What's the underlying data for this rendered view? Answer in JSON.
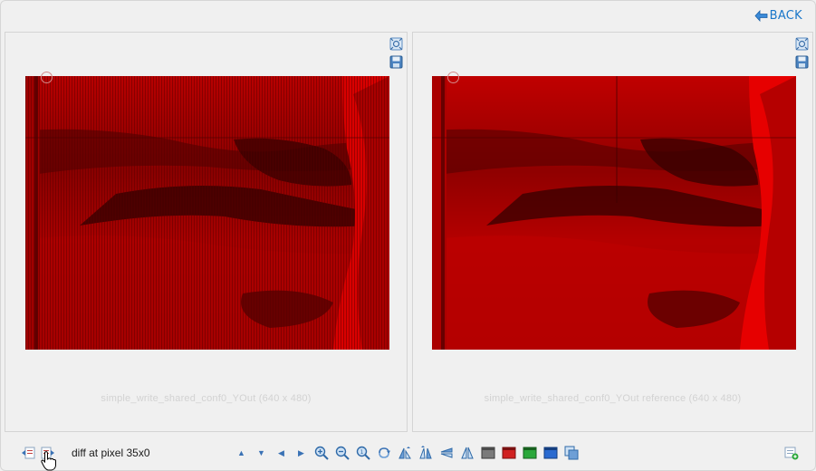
{
  "header": {
    "back_label": "BACK"
  },
  "panels": {
    "left": {
      "caption": "simple_write_shared_conf0_YOut (640 x 480)"
    },
    "right": {
      "caption": "simple_write_shared_conf0_YOut reference (640 x 480)"
    }
  },
  "status": {
    "text": "diff at pixel 35x0"
  },
  "toolbar": {
    "nav_icons": [
      "arrow-up-icon",
      "arrow-down-icon",
      "arrow-left-icon",
      "arrow-right-icon"
    ],
    "tool_icons": [
      "zoom-in-icon",
      "zoom-out-icon",
      "zoom-fit-icon",
      "rotate-icon",
      "flip-vertical-icon",
      "mirror-icon",
      "flip-horizontal-icon",
      "flip-icon",
      "grayscale-channel-icon",
      "red-channel-icon",
      "green-channel-icon",
      "blue-channel-icon",
      "overlay-icon"
    ]
  },
  "colors": {
    "accent": "#1a77c9",
    "image_red": "#cc0000",
    "image_dark": "#3a0000"
  }
}
